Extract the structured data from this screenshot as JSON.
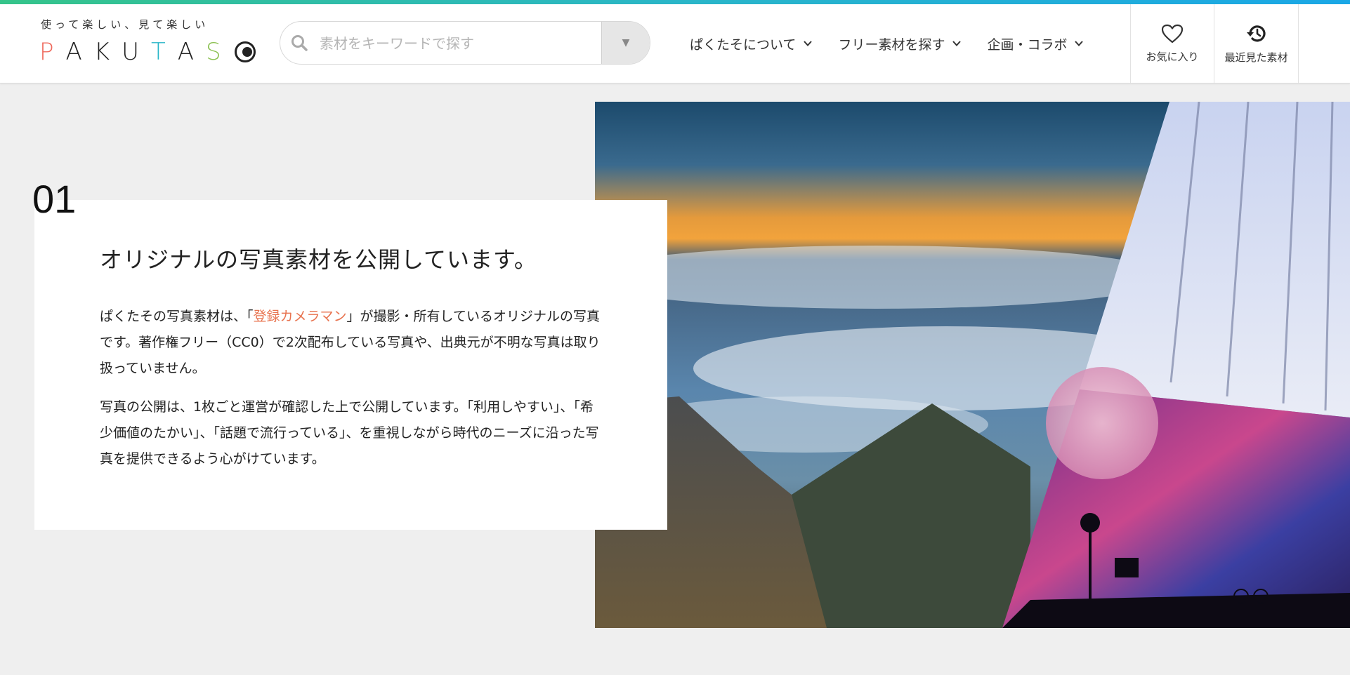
{
  "logo": {
    "tagline": "使って楽しい、見て楽しい",
    "letters": [
      "P",
      "A",
      "K",
      "U",
      "T",
      "A",
      "S"
    ],
    "letter_colors": [
      "#ef6a5d",
      "#222222",
      "#222222",
      "#222222",
      "#2ab6c8",
      "#222222",
      "#8cc152"
    ]
  },
  "search": {
    "placeholder": "素材をキーワードで探す",
    "value": "",
    "dropdown_symbol": "▼"
  },
  "nav": [
    {
      "label": "ぱくたそについて"
    },
    {
      "label": "フリー素材を探す"
    },
    {
      "label": "企画・コラボ"
    }
  ],
  "header_buttons": {
    "favorites": "お気に入り",
    "recent": "最近見た素材"
  },
  "section": {
    "number": "01",
    "title": "オリジナルの写真素材を公開しています。",
    "p1_before": "ぱくたその写真素材は、「",
    "p1_link": "登録カメラマン",
    "p1_after": "」が撮影・所有しているオリジナルの写真です。著作権フリー（CC0）で2次配布している写真や、出典元が不明な写真は取り扱っていません。",
    "p2": "写真の公開は、1枚ごと運営が確認した上で公開しています。「利用しやすい」、「希少価値のたかい」、「話題で流行っている」、を重視しながら時代のニーズに沿った写真を提供できるよう心がけています。"
  },
  "colors": {
    "accent_link": "#e8734f",
    "topbar_start": "#35c48a",
    "topbar_end": "#1aa7e6",
    "background": "#efefef"
  }
}
